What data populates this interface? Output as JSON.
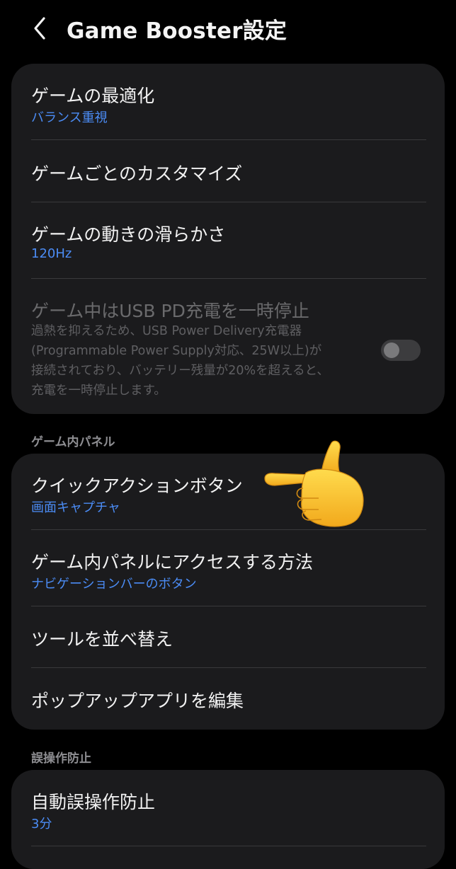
{
  "header": {
    "title": "Game Booster設定",
    "back_icon": "chevron-left-icon"
  },
  "card1": {
    "game_optimization": {
      "title": "ゲームの最適化",
      "value": "バランス重視"
    },
    "per_game_customize": {
      "title": "ゲームごとのカスタマイズ"
    },
    "game_motion_smoothness": {
      "title": "ゲームの動きの滑らかさ",
      "value": "120Hz"
    },
    "pause_usb_pd": {
      "title": "ゲーム中はUSB PD充電を一時停止",
      "description_lines": [
        "過熱を抑えるため、USB Power Delivery充電器",
        "(Programmable Power Supply対応、25W以上)が",
        "接続されており、バッテリー残量が20%を超えると、",
        "充電を一時停止します。"
      ],
      "toggle_on": false
    }
  },
  "in_game_panel": {
    "section_label": "ゲーム内パネル",
    "quick_action_button": {
      "title": "クイックアクションボタン",
      "value": "画面キャプチャ"
    },
    "access_method": {
      "title": "ゲーム内パネルにアクセスする方法",
      "value": "ナビゲーションバーのボタン"
    },
    "reorder_tools": {
      "title": "ツールを並べ替え"
    },
    "edit_popup_apps": {
      "title": "ポップアップアプリを編集"
    }
  },
  "prevent_misoperation": {
    "section_label": "誤操作防止",
    "auto_prevent": {
      "title": "自動誤操作防止",
      "value": "3分"
    }
  },
  "overlay": {
    "icon": "pointing-hand-icon"
  },
  "colors": {
    "background": "#000000",
    "card": "#1b1b1d",
    "accent": "#4b8cf5",
    "divider": "#3a3a3c"
  }
}
